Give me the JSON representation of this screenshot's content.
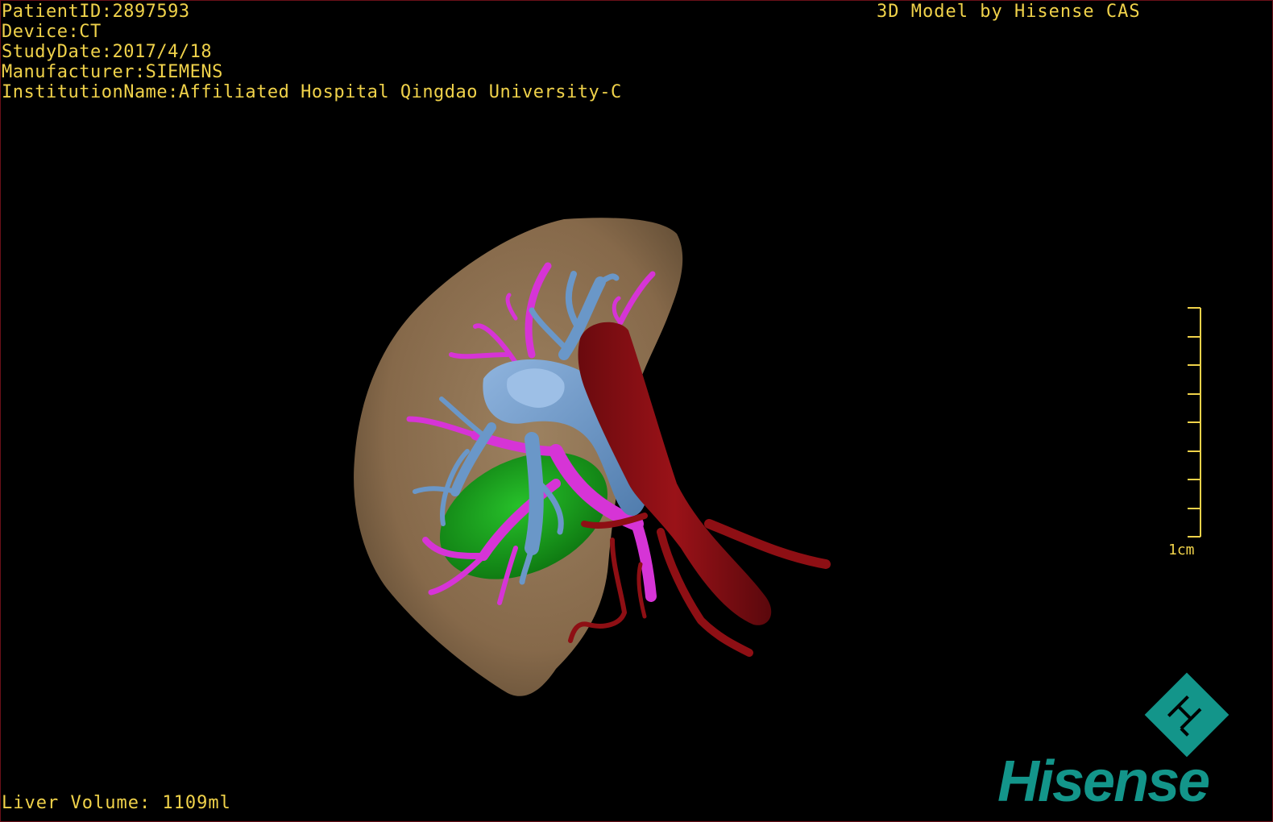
{
  "overlay": {
    "patient_id": "PatientID:2897593",
    "device": "Device:CT",
    "study_date": "StudyDate:2017/4/18",
    "manufacturer": "Manufacturer:SIEMENS",
    "institution": "InstitutionName:Affiliated Hospital Qingdao University-C",
    "brand_caption": "3D Model by Hisense CAS",
    "liver_volume": "Liver Volume: 1109ml"
  },
  "scale_bar": {
    "label": "1cm",
    "ticks": 9,
    "color": "#f0d24a"
  },
  "logo": {
    "text": "Hisense",
    "color": "#13958a"
  },
  "model_colors": {
    "liver": "#8e7554",
    "portal_vein": "#6a97c8",
    "hepatic_vein": "#d634d6",
    "artery_ivc": "#8e0f14",
    "gallbladder": "#19a11c",
    "background": "#000000"
  }
}
